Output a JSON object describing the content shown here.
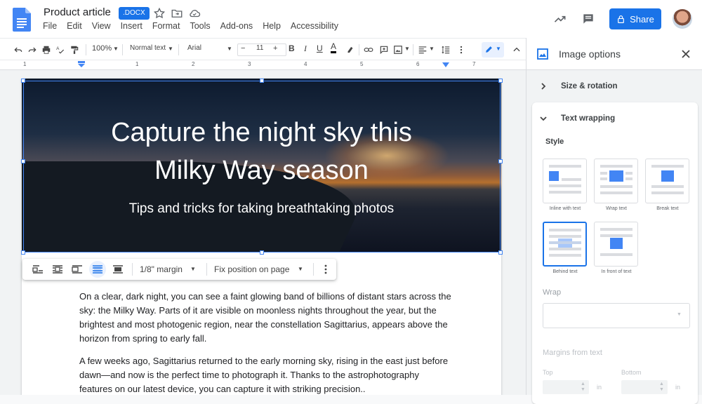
{
  "header": {
    "title": "Product article",
    "badge": ".DOCX",
    "menu": [
      "File",
      "Edit",
      "View",
      "Insert",
      "Format",
      "Tools",
      "Add-ons",
      "Help",
      "Accessibility"
    ],
    "share_label": "Share"
  },
  "toolbar": {
    "zoom": "100%",
    "style": "Normal text",
    "font": "Arial",
    "font_size": "11",
    "font_size_minus": "−",
    "font_size_plus": "+",
    "bold": "B",
    "italic": "I",
    "underline": "U",
    "text_color": "A"
  },
  "ruler": {
    "numbers": [
      "1",
      "1",
      "2",
      "3",
      "4",
      "5",
      "6",
      "7"
    ]
  },
  "document": {
    "hero_title_line1": "Capture the night sky this",
    "hero_title_line2": "Milky Way season",
    "hero_subtitle": "Tips and tricks for taking breathtaking photos",
    "image_toolbar": {
      "margin": "1/8\" margin",
      "position": "Fix position on page"
    },
    "paragraphs": [
      "On a clear, dark night, you can see a faint glowing band of billions of distant stars across the sky: the Milky Way. Parts of it are visible on moonless nights throughout the year, but the brightest and most photogenic region, near the constellation Sagittarius, appears above the horizon from spring to early fall.",
      "A few weeks ago, Sagittarius returned to the early morning sky, rising in the east just before dawn—and now is the perfect time to photograph it. Thanks to the astrophotography features on our latest device, you can capture it with striking precision.."
    ]
  },
  "panel": {
    "title": "Image options",
    "section_size": "Size & rotation",
    "section_wrapping": "Text wrapping",
    "style_label": "Style",
    "options": [
      "Inline with text",
      "Wrap text",
      "Break text",
      "Behind text",
      "In front of text"
    ],
    "selected_option": "Behind text",
    "wrap_label": "Wrap",
    "margins_label": "Margins from text",
    "top_label": "Top",
    "bottom_label": "Bottom",
    "unit": "in"
  },
  "colors": {
    "accent": "#1a73e8",
    "handle": "#4285f4"
  }
}
